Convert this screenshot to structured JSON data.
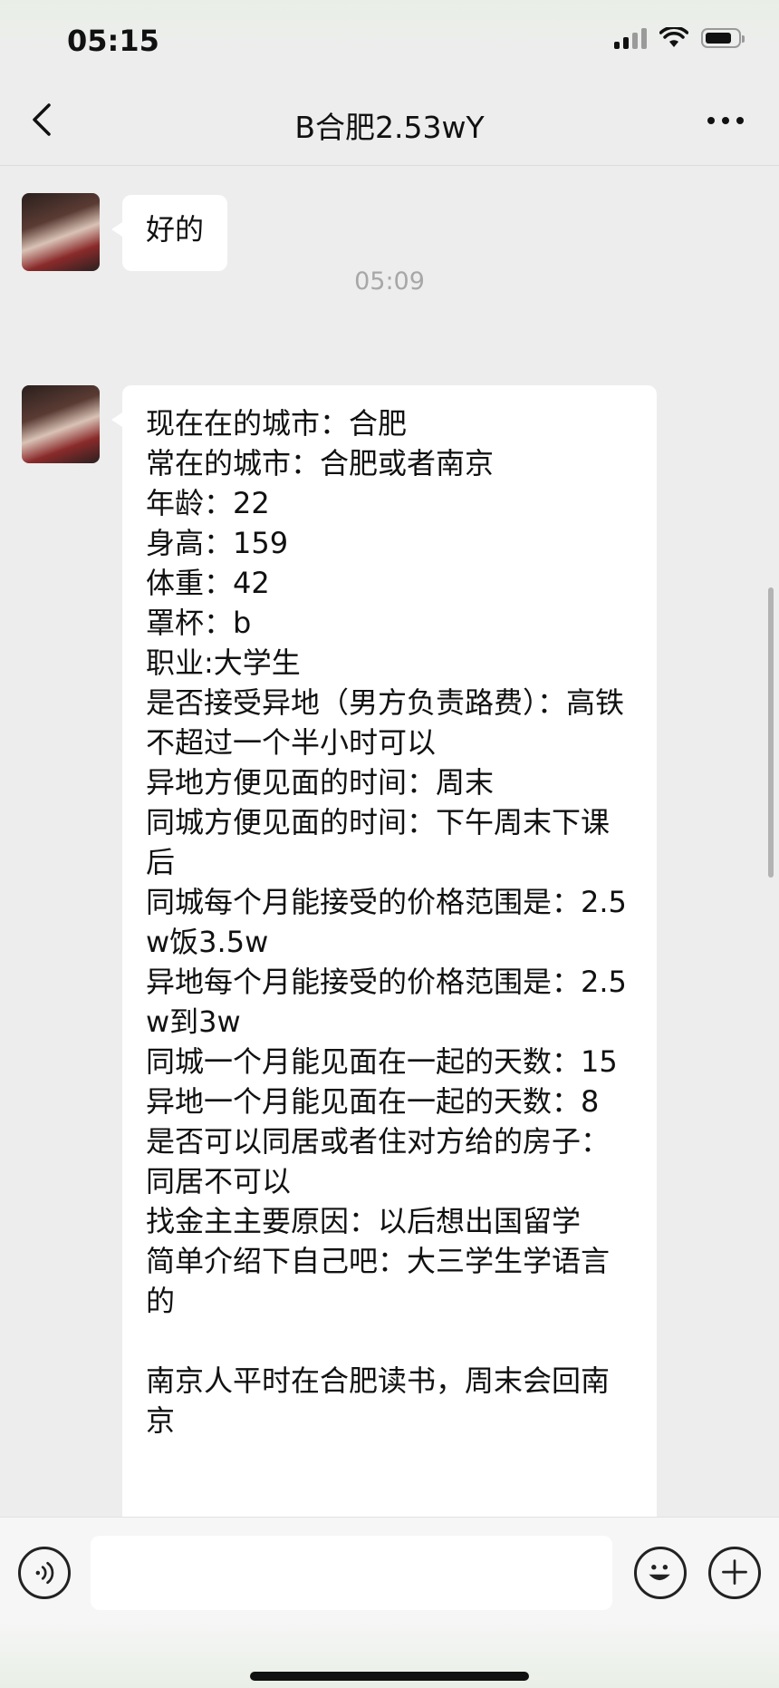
{
  "status_bar": {
    "time": "05:15"
  },
  "header": {
    "title": "B合肥2.53wY"
  },
  "messages": [
    {
      "type": "text",
      "sender": "contact",
      "text": "好的"
    },
    {
      "type": "time",
      "text": "05:09"
    },
    {
      "type": "text",
      "sender": "contact",
      "text": "现在在的城市：合肥\n常在的城市：合肥或者南京\n年龄：22\n身高：159\n体重：42\n罩杯：b\n职业:大学生\n是否接受异地（男方负责路费）：高铁不超过一个半小时可以\n异地方便见面的时间：周末\n同城方便见面的时间：下午周末下课后\n同城每个月能接受的价格范围是：2.5w饭3.5w\n异地每个月能接受的价格范围是：2.5w到3w\n同城一个月能见面在一起的天数：15\n异地一个月能见面在一起的天数：8\n是否可以同居或者住对方给的房子：同居不可以\n找金主主要原因：以后想出国留学\n简单介绍下自己吧：大三学生学语言的\n\n南京人平时在合肥读书，周末会回南京"
    }
  ],
  "input_bar": {
    "placeholder": ""
  }
}
